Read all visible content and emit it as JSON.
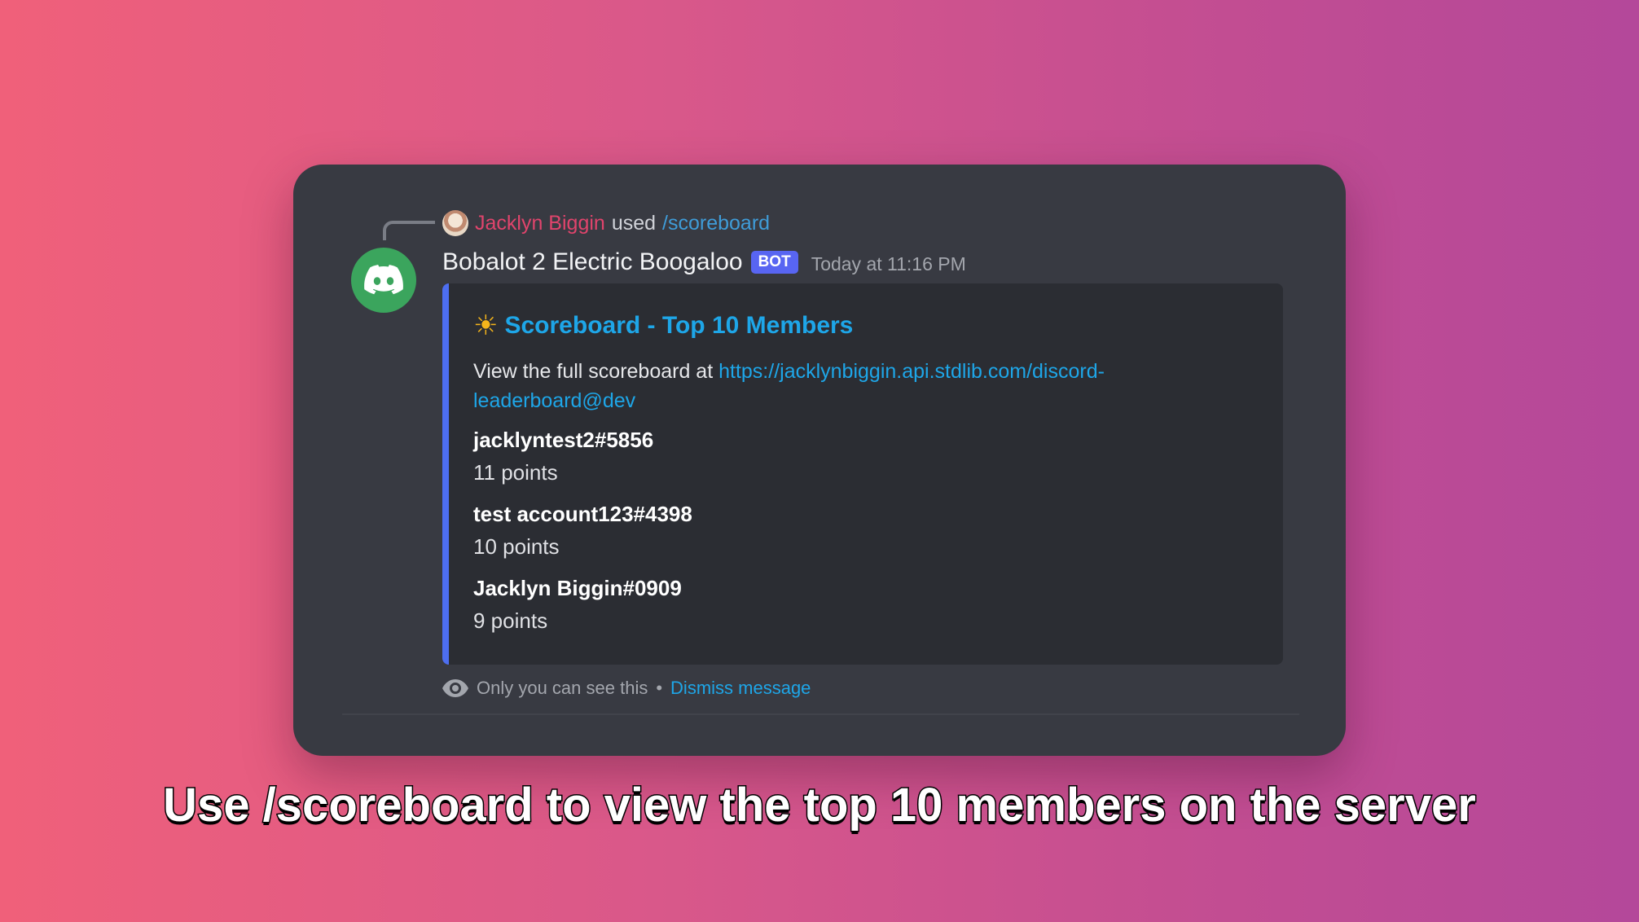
{
  "reply": {
    "user": "Jacklyn Biggin",
    "verb": "used",
    "command": "/scoreboard"
  },
  "message": {
    "author": "Bobalot 2 Electric Boogaloo",
    "badge": "BOT",
    "timestamp": "Today at 11:16 PM",
    "avatar_icon": "discord-logo-icon"
  },
  "embed": {
    "accent_color": "#4d6ef0",
    "title_icon": "sun-icon",
    "title": "Scoreboard - Top 10 Members",
    "description_prefix": "View the full scoreboard at ",
    "description_link": "https://jacklynbiggin.api.stdlib.com/discord-leaderboard@dev",
    "members": [
      {
        "name": "jacklyntest2#5856",
        "points": "11 points"
      },
      {
        "name": "test account123#4398",
        "points": "10 points"
      },
      {
        "name": "Jacklyn Biggin#0909",
        "points": "9 points"
      }
    ]
  },
  "notice": {
    "icon": "eye-icon",
    "text": "Only you can see this",
    "separator": "•",
    "dismiss": "Dismiss message"
  },
  "caption": "Use /scoreboard to view the top 10 members on the server"
}
